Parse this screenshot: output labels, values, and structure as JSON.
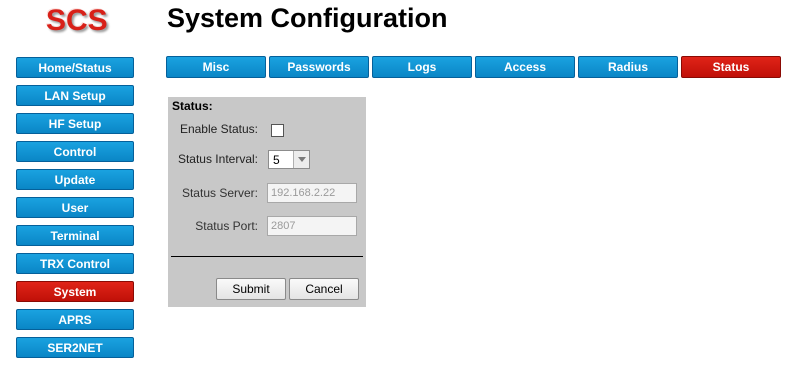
{
  "logo": {
    "text": "SCS"
  },
  "page_title": "System Configuration",
  "sidebar": {
    "items": [
      {
        "label": "Home/Status",
        "active": false
      },
      {
        "label": "LAN Setup",
        "active": false
      },
      {
        "label": "HF Setup",
        "active": false
      },
      {
        "label": "Control",
        "active": false
      },
      {
        "label": "Update",
        "active": false
      },
      {
        "label": "User",
        "active": false
      },
      {
        "label": "Terminal",
        "active": false
      },
      {
        "label": "TRX Control",
        "active": false
      },
      {
        "label": "System",
        "active": true
      },
      {
        "label": "APRS",
        "active": false
      },
      {
        "label": "SER2NET",
        "active": false
      }
    ]
  },
  "tabs": [
    {
      "label": "Misc",
      "active": false
    },
    {
      "label": "Passwords",
      "active": false
    },
    {
      "label": "Logs",
      "active": false
    },
    {
      "label": "Access",
      "active": false
    },
    {
      "label": "Radius",
      "active": false
    },
    {
      "label": "Status",
      "active": true
    }
  ],
  "form": {
    "section_title": "Status:",
    "enable_status": {
      "label": "Enable Status:",
      "checked": false
    },
    "status_interval": {
      "label": "Status Interval:",
      "value": "5",
      "icon": "chevron-down-icon"
    },
    "status_server": {
      "label": "Status Server:",
      "placeholder": "192.168.2.22",
      "value": ""
    },
    "status_port": {
      "label": "Status Port:",
      "placeholder": "2807",
      "value": ""
    },
    "submit_label": "Submit",
    "cancel_label": "Cancel"
  },
  "colors": {
    "accent_blue": "#0a86c6",
    "active_red": "#d21a10",
    "logo_red": "#d82018",
    "panel_gray": "#c8c8c8"
  }
}
